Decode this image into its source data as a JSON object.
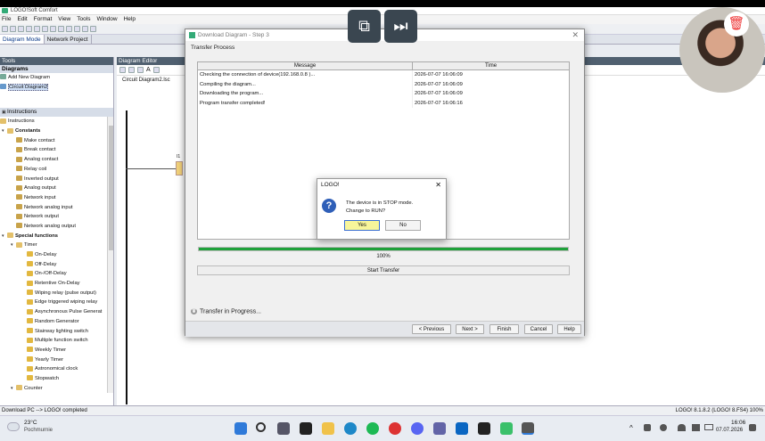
{
  "app": {
    "title": "LOGO!Soft Comfort",
    "menu": [
      "File",
      "Edit",
      "Format",
      "View",
      "Tools",
      "Window",
      "Help"
    ],
    "mode_tabs": [
      "Diagram Mode",
      "Network Project"
    ]
  },
  "tools_panel": {
    "header": "Tools",
    "diagrams_label": "Diagrams",
    "diagram_items": [
      "Add New Diagram",
      "Circuit Diagram2"
    ],
    "instructions_header": "Instructions",
    "instructions_label": "Instructions",
    "constants_label": "Constants",
    "constants": [
      "Make contact",
      "Break contact",
      "Analog contact",
      "Relay coil",
      "Inverted output",
      "Analog output",
      "Network input",
      "Network analog input",
      "Network output",
      "Network analog output"
    ],
    "special_functions_label": "Special functions",
    "timer_label": "Timer",
    "timers": [
      "On-Delay",
      "Off-Delay",
      "On-/Off-Delay",
      "Retentive On-Delay",
      "Wiping relay (pulse output)",
      "Edge triggered wiping relay",
      "Asynchronous Pulse Generat",
      "Random Generator",
      "Stairway lighting switch",
      "Multiple function switch",
      "Weekly Timer",
      "Yearly Timer",
      "Astronomical clock",
      "Stopwatch"
    ],
    "counter_label": "Counter"
  },
  "editor": {
    "header": "Diagram Editor",
    "tool_glyph": "A",
    "tab": "Circuit Diagram2.lsc",
    "fragment": "I1"
  },
  "download_dialog": {
    "title": "Download Diagram - Step 3",
    "section": "Transfer Process",
    "columns": [
      "Message",
      "Time"
    ],
    "rows": [
      {
        "message": "Checking the connection of device(192.168.0.8 )...",
        "time": "2026-07-07 16:06:09"
      },
      {
        "message": "Compiling the diagram...",
        "time": "2026-07-07 16:06:09"
      },
      {
        "message": "Downloading the program...",
        "time": "2026-07-07 16:06:09"
      },
      {
        "message": "Program transfer completed!",
        "time": "2026-07-07 16:06:16"
      }
    ],
    "progress_percent": 100,
    "progress_label": "100%",
    "start_button": "Start Transfer",
    "in_progress": "Transfer in Progress...",
    "buttons": {
      "previous": "< Previous",
      "next": "Next >",
      "finish": "Finish",
      "cancel": "Cancel",
      "help": "Help"
    }
  },
  "message_box": {
    "title": "LOGO!",
    "line1": "The device is in STOP mode.",
    "line2": "Change to RUN?",
    "yes": "Yes",
    "no": "No"
  },
  "status": {
    "left": "Download PC --> LOGO! completed",
    "right": "LOGO! 8.1.8.2 (LOGO! 8.FS4) 100%"
  },
  "taskbar": {
    "weather_temp": "23°C",
    "weather_desc": "Pochmurnie",
    "time": "16:06",
    "date": "07.07.2026"
  },
  "colors": {
    "progress": "#1fa23a",
    "panel_header": "#506070",
    "accent": "#2f5fb8"
  }
}
